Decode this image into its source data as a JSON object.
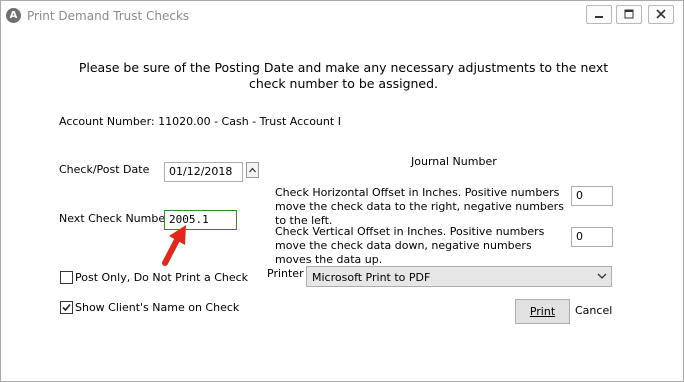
{
  "window": {
    "title": "Print Demand Trust Checks",
    "app_icon_glyph": "A"
  },
  "header_message": "Please be sure of the Posting Date and make any necessary adjustments to the next check number to be assigned.",
  "account_line": "Account Number: 11020.00 - Cash - Trust Account I",
  "check_post_date": {
    "label": "Check/Post Date",
    "value": "01/12/2018"
  },
  "journal_number_label": "Journal Number",
  "next_check": {
    "label": "Next Check Number:",
    "value": "2005.1"
  },
  "horizontal_offset": {
    "label": "Check Horizontal Offset in Inches.  Positive numbers move the check data to the right, negative numbers to the left.",
    "value": "0"
  },
  "vertical_offset": {
    "label": "Check Vertical Offset in Inches.  Positive numbers move the check data down, negative numbers moves the data up.",
    "value": "0"
  },
  "printer": {
    "label": "Printer",
    "selected": "Microsoft Print to PDF"
  },
  "post_only": {
    "label": "Post Only, Do Not Print a Check",
    "checked": false
  },
  "show_client_name": {
    "label": "Show Client's Name on Check",
    "checked": true
  },
  "buttons": {
    "print": "Print",
    "cancel": "Cancel"
  },
  "colors": {
    "arrow": "#e0291b",
    "focus_border": "#2f8a2f",
    "button_border": "#adadad"
  }
}
